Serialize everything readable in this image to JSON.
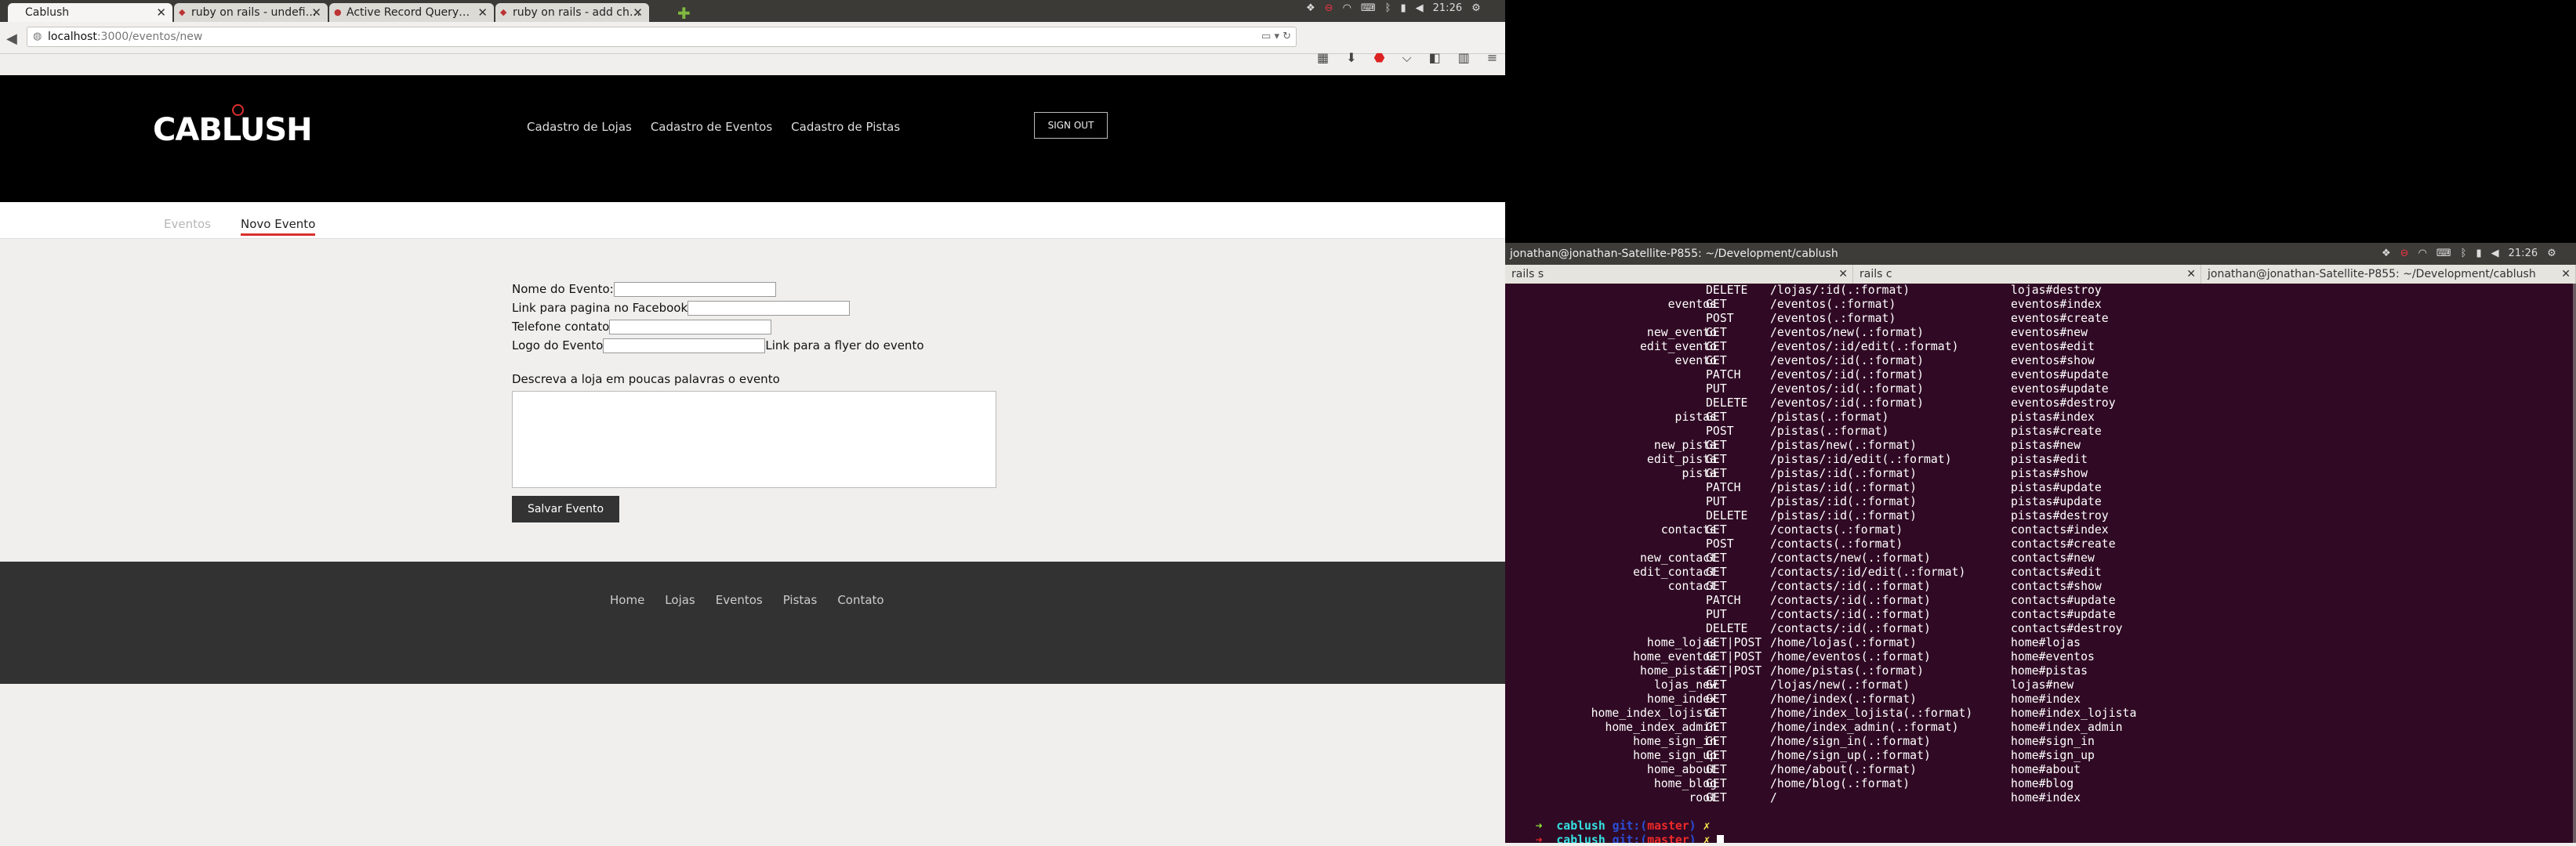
{
  "browser": {
    "tabs": [
      {
        "label": "Cablush",
        "active": true
      },
      {
        "label": "ruby on rails - undefi…",
        "active": false
      },
      {
        "label": "Active Record Query…",
        "active": false
      },
      {
        "label": "ruby on rails - add ch…",
        "active": false
      }
    ],
    "new_tab_symbol": "✚",
    "tray_time": "21:26",
    "url_host": "localhost",
    "url_path": ":3000/eventos/new"
  },
  "site": {
    "logo": "CABLUSH",
    "nav": [
      "Cadastro de Lojas",
      "Cadastro de Eventos",
      "Cadastro de Pistas"
    ],
    "sign_out": "SIGN OUT",
    "subtabs": [
      "Eventos",
      "Novo Evento"
    ],
    "form": {
      "nome_label": "Nome do Evento:",
      "facebook_label": "Link para pagina no Facebook",
      "telefone_label": "Telefone contato",
      "logo_label": "Logo do Evento",
      "flyer_label": "Link para a flyer do evento",
      "desc_label": "Descreva a loja em poucas palavras o evento",
      "save_label": "Salvar Evento"
    },
    "footer_nav": [
      "Home",
      "Lojas",
      "Eventos",
      "Pistas",
      "Contato"
    ]
  },
  "terminal": {
    "title": "jonathan@jonathan-Satellite-P855: ~/Development/cablush",
    "tray_time": "21:26",
    "tabs": [
      "rails s",
      "rails c",
      "jonathan@jonathan-Satellite-P855: ~/Development/cablush"
    ],
    "routes": [
      [
        "",
        "DELETE",
        "/lojas/:id(.:format)",
        "lojas#destroy"
      ],
      [
        "eventos",
        "GET",
        "/eventos(.:format)",
        "eventos#index"
      ],
      [
        "",
        "POST",
        "/eventos(.:format)",
        "eventos#create"
      ],
      [
        "new_evento",
        "GET",
        "/eventos/new(.:format)",
        "eventos#new"
      ],
      [
        "edit_evento",
        "GET",
        "/eventos/:id/edit(.:format)",
        "eventos#edit"
      ],
      [
        "evento",
        "GET",
        "/eventos/:id(.:format)",
        "eventos#show"
      ],
      [
        "",
        "PATCH",
        "/eventos/:id(.:format)",
        "eventos#update"
      ],
      [
        "",
        "PUT",
        "/eventos/:id(.:format)",
        "eventos#update"
      ],
      [
        "",
        "DELETE",
        "/eventos/:id(.:format)",
        "eventos#destroy"
      ],
      [
        "pistas",
        "GET",
        "/pistas(.:format)",
        "pistas#index"
      ],
      [
        "",
        "POST",
        "/pistas(.:format)",
        "pistas#create"
      ],
      [
        "new_pista",
        "GET",
        "/pistas/new(.:format)",
        "pistas#new"
      ],
      [
        "edit_pista",
        "GET",
        "/pistas/:id/edit(.:format)",
        "pistas#edit"
      ],
      [
        "pista",
        "GET",
        "/pistas/:id(.:format)",
        "pistas#show"
      ],
      [
        "",
        "PATCH",
        "/pistas/:id(.:format)",
        "pistas#update"
      ],
      [
        "",
        "PUT",
        "/pistas/:id(.:format)",
        "pistas#update"
      ],
      [
        "",
        "DELETE",
        "/pistas/:id(.:format)",
        "pistas#destroy"
      ],
      [
        "contacts",
        "GET",
        "/contacts(.:format)",
        "contacts#index"
      ],
      [
        "",
        "POST",
        "/contacts(.:format)",
        "contacts#create"
      ],
      [
        "new_contact",
        "GET",
        "/contacts/new(.:format)",
        "contacts#new"
      ],
      [
        "edit_contact",
        "GET",
        "/contacts/:id/edit(.:format)",
        "contacts#edit"
      ],
      [
        "contact",
        "GET",
        "/contacts/:id(.:format)",
        "contacts#show"
      ],
      [
        "",
        "PATCH",
        "/contacts/:id(.:format)",
        "contacts#update"
      ],
      [
        "",
        "PUT",
        "/contacts/:id(.:format)",
        "contacts#update"
      ],
      [
        "",
        "DELETE",
        "/contacts/:id(.:format)",
        "contacts#destroy"
      ],
      [
        "home_lojas",
        "GET|POST",
        "/home/lojas(.:format)",
        "home#lojas"
      ],
      [
        "home_eventos",
        "GET|POST",
        "/home/eventos(.:format)",
        "home#eventos"
      ],
      [
        "home_pistas",
        "GET|POST",
        "/home/pistas(.:format)",
        "home#pistas"
      ],
      [
        "lojas_new",
        "GET",
        "/lojas/new(.:format)",
        "lojas#new"
      ],
      [
        "home_index",
        "GET",
        "/home/index(.:format)",
        "home#index"
      ],
      [
        "home_index_lojista",
        "GET",
        "/home/index_lojista(.:format)",
        "home#index_lojista"
      ],
      [
        "home_index_admin",
        "GET",
        "/home/index_admin(.:format)",
        "home#index_admin"
      ],
      [
        "home_sign_in",
        "GET",
        "/home/sign_in(.:format)",
        "home#sign_in"
      ],
      [
        "home_sign_up",
        "GET",
        "/home/sign_up(.:format)",
        "home#sign_up"
      ],
      [
        "home_about",
        "GET",
        "/home/about(.:format)",
        "home#about"
      ],
      [
        "home_blog",
        "GET",
        "/home/blog(.:format)",
        "home#blog"
      ],
      [
        "root",
        "GET",
        "/",
        "home#index"
      ]
    ],
    "prompt": {
      "arrow": "➜",
      "dir": "cablush",
      "git": "git:(",
      "branch": "master",
      "git_close": ")",
      "dirty": "✗"
    }
  }
}
